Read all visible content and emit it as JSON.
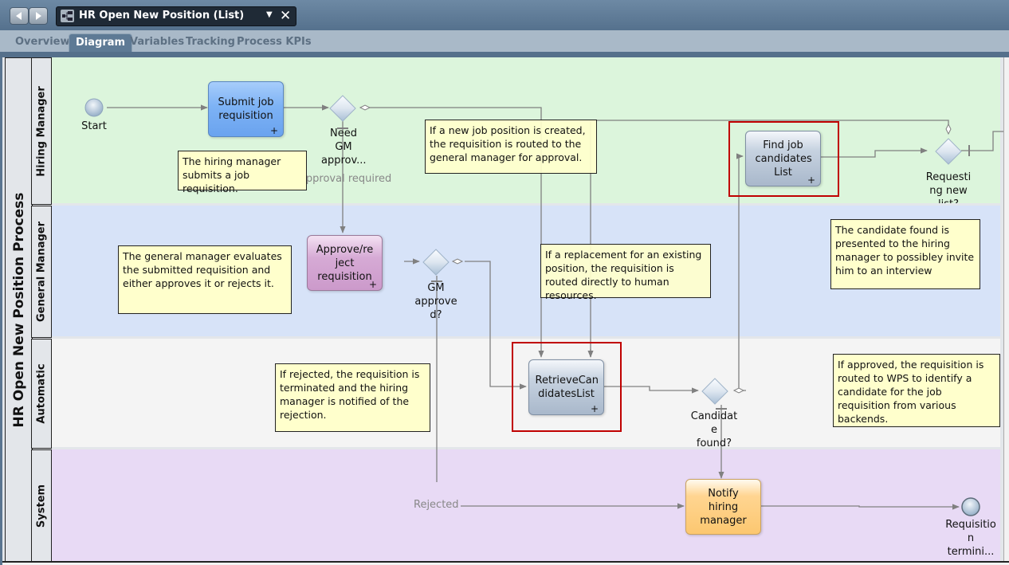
{
  "window": {
    "title": "HR Open New Position (List)",
    "back_icon": "left-arrow",
    "forward_icon": "right-arrow",
    "process_icon": "process-diagram-icon",
    "dropdown_icon": "▼",
    "close_icon": "✕"
  },
  "tabs": [
    {
      "label": "Overview",
      "active": false
    },
    {
      "label": "Diagram",
      "active": true
    },
    {
      "label": "Variables",
      "active": false
    },
    {
      "label": "Tracking",
      "active": false
    },
    {
      "label": "Process KPIs",
      "active": false
    }
  ],
  "diagram": {
    "pool_name": "HR Open New Position Process",
    "lanes": [
      {
        "name": "Hiring Manager",
        "color": "#dcf5dc"
      },
      {
        "name": "General Manager",
        "color": "#d7e3f8"
      },
      {
        "name": "Automatic",
        "color": "#f4f4f4"
      },
      {
        "name": "System",
        "color": "#e8daf5"
      }
    ],
    "events": {
      "start": "Start",
      "end": "Requisitio\nn\ntermini..."
    },
    "tasks": {
      "submit": {
        "label": "Submit job requisition",
        "plus": "+"
      },
      "approve": {
        "label": "Approve/re ject requisition",
        "plus": "+"
      },
      "retrieve": {
        "label": "RetrieveCan didatesList",
        "plus": "+"
      },
      "find": {
        "label": "Find job candidates List",
        "plus": "+"
      },
      "notify": {
        "label": "Notify hiring manager"
      }
    },
    "gateways": {
      "need_gm": "Need\nGM\napprov...",
      "gm_approved": "GM\napprove\nd?",
      "candidate_found": "Candidat\ne\nfound?",
      "requesting": "Requesti\nng new\nlist?"
    },
    "flow_labels": {
      "approval_required": "Approval required",
      "rejected": "Rejected"
    },
    "notes": {
      "hiring_submits": "The hiring manager submits a job requisition.",
      "new_position": "If a new job position is created, the requisition is routed to the general manager for approval.",
      "gm_evaluates": "The general manager evaluates the submitted requisition and either approves it or rejects it.",
      "replacement": "If a replacement for an existing position, the requisition is routed directly to human resources.",
      "candidate_presented": "The candidate found is presented to the hiring manager to possibley invite him to an interview",
      "rejected": "If rejected, the requisition is terminated and the hiring manager is notified of the rejection.",
      "approved_wps": "If approved, the requisition is routed to WPS to identify a candidate for the job requisition from various backends."
    }
  }
}
